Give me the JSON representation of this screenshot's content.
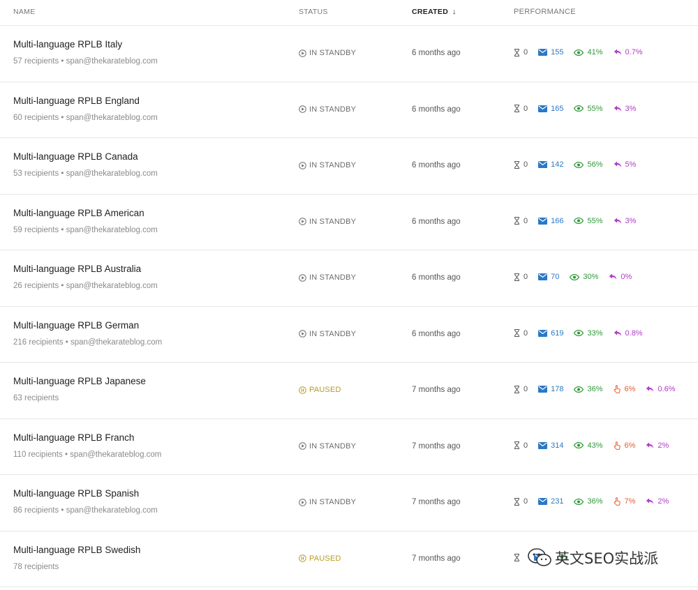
{
  "columns": {
    "name": "NAME",
    "status": "STATUS",
    "created": "CREATED",
    "performance": "PERFORMANCE"
  },
  "colors": {
    "sent": "#2b78c5",
    "open": "#2e9a37",
    "click": "#e45e2c",
    "reply": "#b13bc9",
    "paused": "#b89a1f",
    "standby": "#6b6b6b"
  },
  "icons": {
    "wait": "hourglass-icon",
    "sent": "envelope-icon",
    "open": "eye-icon",
    "click": "hand-pointer-icon",
    "reply": "reply-arrow-icon",
    "standby": "play-circle-icon",
    "paused": "pause-circle-icon",
    "sort": "arrow-down-icon"
  },
  "campaigns": [
    {
      "name": "Multi-language RPLB Italy",
      "sub": "57 recipients • span@thekarateblog.com",
      "status": "IN STANDBY",
      "status_kind": "standby",
      "created": "6 months ago",
      "wait": "0",
      "sent": "155",
      "open": "41%",
      "click": null,
      "reply": "0.7%"
    },
    {
      "name": "Multi-language RPLB England",
      "sub": "60 recipients • span@thekarateblog.com",
      "status": "IN STANDBY",
      "status_kind": "standby",
      "created": "6 months ago",
      "wait": "0",
      "sent": "165",
      "open": "55%",
      "click": null,
      "reply": "3%"
    },
    {
      "name": "Multi-language RPLB Canada",
      "sub": "53 recipients • span@thekarateblog.com",
      "status": "IN STANDBY",
      "status_kind": "standby",
      "created": "6 months ago",
      "wait": "0",
      "sent": "142",
      "open": "56%",
      "click": null,
      "reply": "5%"
    },
    {
      "name": "Multi-language RPLB American",
      "sub": "59 recipients • span@thekarateblog.com",
      "status": "IN STANDBY",
      "status_kind": "standby",
      "created": "6 months ago",
      "wait": "0",
      "sent": "166",
      "open": "55%",
      "click": null,
      "reply": "3%"
    },
    {
      "name": "Multi-language RPLB Australia",
      "sub": "26 recipients • span@thekarateblog.com",
      "status": "IN STANDBY",
      "status_kind": "standby",
      "created": "6 months ago",
      "wait": "0",
      "sent": "70",
      "open": "30%",
      "click": null,
      "reply": "0%"
    },
    {
      "name": "Multi-language RPLB German",
      "sub": "216 recipients • span@thekarateblog.com",
      "status": "IN STANDBY",
      "status_kind": "standby",
      "created": "6 months ago",
      "wait": "0",
      "sent": "619",
      "open": "33%",
      "click": null,
      "reply": "0.8%"
    },
    {
      "name": "Multi-language RPLB Japanese",
      "sub": "63 recipients",
      "status": "PAUSED",
      "status_kind": "paused",
      "created": "7 months ago",
      "wait": "0",
      "sent": "178",
      "open": "36%",
      "click": "6%",
      "reply": "0.6%"
    },
    {
      "name": "Multi-language RPLB Franch",
      "sub": "110 recipients • span@thekarateblog.com",
      "status": "IN STANDBY",
      "status_kind": "standby",
      "created": "7 months ago",
      "wait": "0",
      "sent": "314",
      "open": "43%",
      "click": "6%",
      "reply": "2%"
    },
    {
      "name": "Multi-language RPLB Spanish",
      "sub": "86 recipients • span@thekarateblog.com",
      "status": "IN STANDBY",
      "status_kind": "standby",
      "created": "7 months ago",
      "wait": "0",
      "sent": "231",
      "open": "36%",
      "click": "7%",
      "reply": "2%"
    },
    {
      "name": "Multi-language RPLB Swedish",
      "sub": "78 recipients",
      "status": "PAUSED",
      "status_kind": "paused",
      "created": "7 months ago",
      "wait": "",
      "sent": "",
      "open": "",
      "click": null,
      "reply": null
    }
  ],
  "watermark": {
    "text": "英文SEO实战派",
    "icon": "wechat-logo-icon"
  }
}
